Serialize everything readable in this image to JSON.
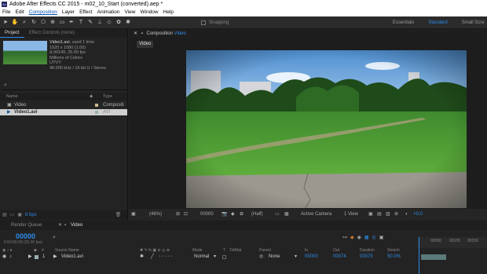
{
  "window": {
    "title": "Adobe After Effects CC 2015 - m02_10_Start (converted).aep *"
  },
  "menu": [
    "File",
    "Edit",
    "Composition",
    "Layer",
    "Effect",
    "Animation",
    "View",
    "Window",
    "Help"
  ],
  "toolbar": {
    "snapping": "Snapping",
    "workspaces": [
      "Essentials",
      "Standard",
      "Small Scre"
    ]
  },
  "project": {
    "tabs": [
      "Project",
      "Effect Controls (none)"
    ],
    "info": {
      "name": "Video1.avi",
      "used": ", used 1 time",
      "size": "1920 x 1080 (1.00)",
      "duration": "Δ 00149, 25.00 fps",
      "colors": "Millions of Colors",
      "codec": "UYVY",
      "audio": "48.000 kHz / 16 bit U / Stereo"
    },
    "search_icon": "magnifier",
    "columns": {
      "name": "Name",
      "type": "Type"
    },
    "items": [
      {
        "name": "Video",
        "type": "Compositi"
      },
      {
        "name": "Video1.avi",
        "type": "AVI"
      }
    ],
    "footer": {
      "bpc": "8 bpc"
    }
  },
  "composition": {
    "tab_prefix": "Composition",
    "tab_name": "Video",
    "subtab": "Video",
    "zoom": "(46%)",
    "timecode": "00000",
    "resolution": "(Half)",
    "camera": "Active Camera",
    "views": "1 View",
    "exposure": "+0.0"
  },
  "timeline": {
    "tabs": [
      "Render Queue",
      "Video"
    ],
    "timecode": "00000",
    "subtimecode": "0:00:00:00 (25.00 fps)",
    "columns": {
      "source": "Source Name",
      "mode": "Mode",
      "t": "T",
      "trkmat": "TrkMat",
      "parent": "Parent",
      "in": "In",
      "out": "Out",
      "duration": "Duration",
      "stretch": "Stretch"
    },
    "layer": {
      "index": "1",
      "name": "Video1.avi",
      "mode": "Normal",
      "parent": "None",
      "in": "00000",
      "out": "00074",
      "duration": "00075",
      "stretch": "50.0%"
    },
    "ruler": [
      "00050",
      "00100",
      "00150"
    ]
  }
}
